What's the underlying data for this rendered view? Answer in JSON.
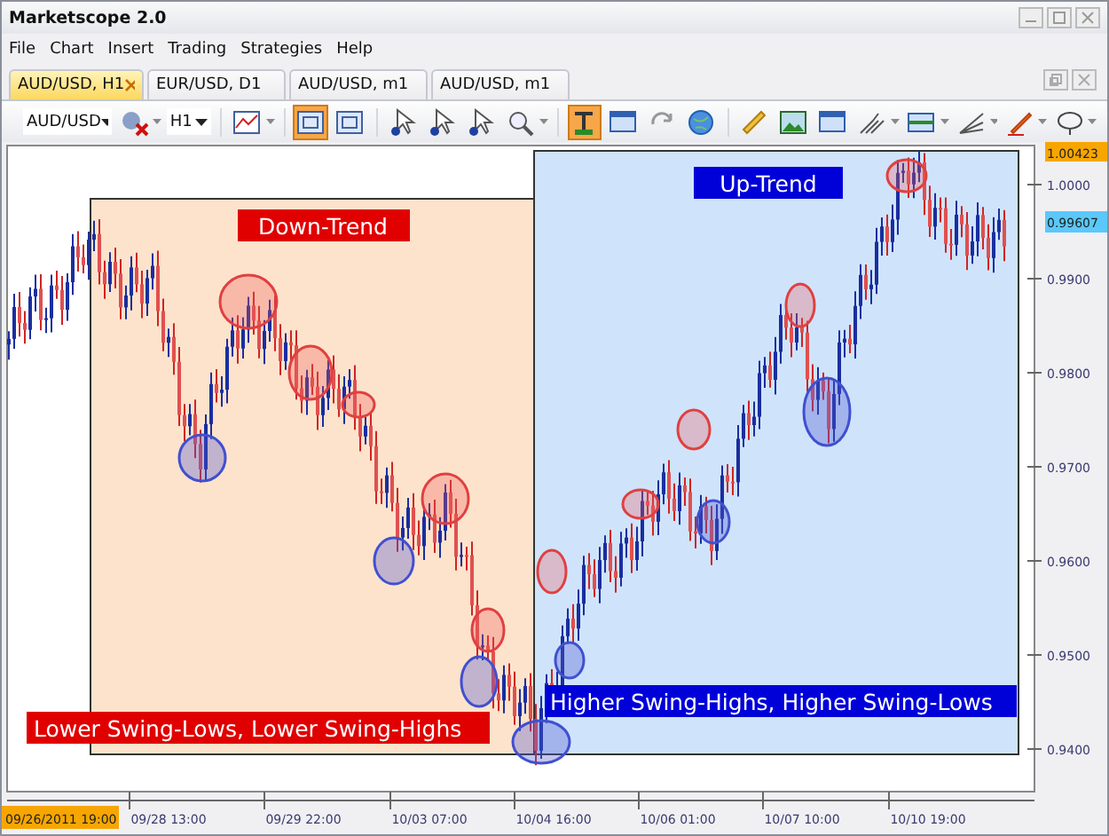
{
  "window": {
    "title": "Marketscope 2.0"
  },
  "menu": [
    "File",
    "Chart",
    "Insert",
    "Trading",
    "Strategies",
    "Help"
  ],
  "tabs": [
    {
      "label": "AUD/USD, H1",
      "selected": true
    },
    {
      "label": "EUR/USD, D1",
      "selected": false
    },
    {
      "label": "AUD/USD, m1",
      "selected": false
    },
    {
      "label": "AUD/USD, m1",
      "selected": false
    }
  ],
  "toolbar": {
    "symbol": "AUD/USD",
    "timeframe": "H1",
    "buttons": [
      {
        "kind": "indicator",
        "selected": false,
        "dropdown": true
      },
      {
        "kind": "chart",
        "selected": false,
        "dropdown": true
      },
      {
        "kind": "grid",
        "selected": true,
        "dropdown": false
      },
      {
        "kind": "grid",
        "selected": false,
        "dropdown": false
      },
      {
        "kind": "cursor",
        "selected": false,
        "dropdown": false
      },
      {
        "kind": "cursor",
        "selected": false,
        "dropdown": false
      },
      {
        "kind": "cursor",
        "selected": false,
        "dropdown": false
      },
      {
        "kind": "zoom",
        "selected": false,
        "dropdown": true
      },
      {
        "kind": "marker",
        "selected": true,
        "dropdown": false
      },
      {
        "kind": "window",
        "selected": false,
        "dropdown": false
      },
      {
        "kind": "refresh",
        "selected": false,
        "dropdown": false
      },
      {
        "kind": "globe",
        "selected": false,
        "dropdown": false
      },
      {
        "kind": "ruler",
        "selected": false,
        "dropdown": false
      },
      {
        "kind": "image",
        "selected": false,
        "dropdown": false
      },
      {
        "kind": "window",
        "selected": false,
        "dropdown": false
      },
      {
        "kind": "fork",
        "selected": false,
        "dropdown": true
      },
      {
        "kind": "line",
        "selected": false,
        "dropdown": true
      },
      {
        "kind": "fan",
        "selected": false,
        "dropdown": true
      },
      {
        "kind": "pencil",
        "selected": false,
        "dropdown": true
      },
      {
        "kind": "ellipse",
        "selected": false,
        "dropdown": true
      }
    ]
  },
  "chart": {
    "down_trend": {
      "label": "Down-Trend",
      "caption": "Lower Swing-Lows, Lower Swing-Highs"
    },
    "up_trend": {
      "label": "Up-Trend",
      "caption": "Higher Swing-Highs, Higher Swing-Lows"
    },
    "high_price": "1.00423",
    "current_price": "0.99607",
    "y_axis_labels": [
      "1.0000",
      "0.9900",
      "0.9800",
      "0.9700",
      "0.9600",
      "0.9500",
      "0.9400"
    ],
    "start_time": "09/26/2011 19:00",
    "x_axis_labels": [
      "09/28 13:00",
      "09/29 22:00",
      "10/03 07:00",
      "10/04 16:00",
      "10/06 01:00",
      "10/07 10:00",
      "10/10 19:00"
    ]
  }
}
